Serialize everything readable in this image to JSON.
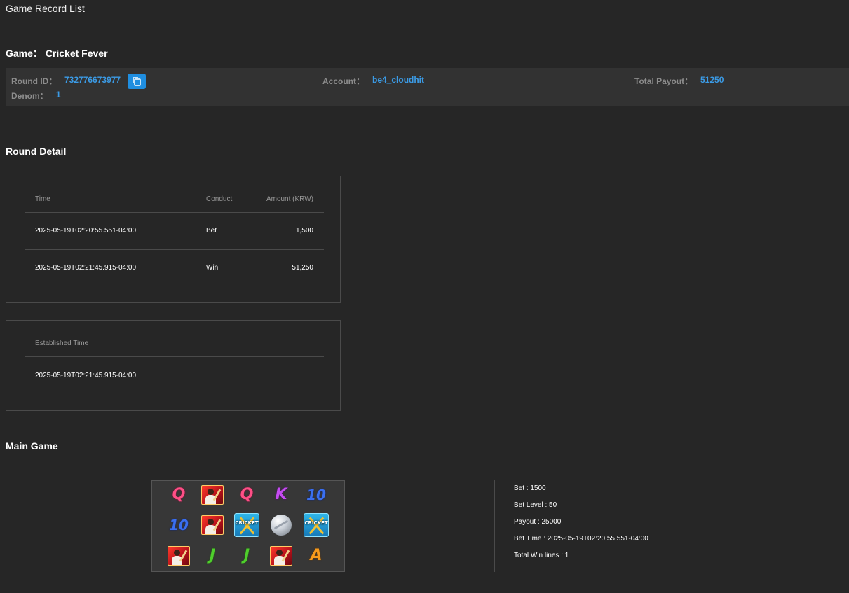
{
  "app_title": "Game Record List",
  "game": {
    "label": "Game：",
    "name": "Cricket Fever"
  },
  "round_info": {
    "round_id_label": "Round ID：",
    "round_id": "732776673977",
    "account_label": "Account：",
    "account": "be4_cloudhit",
    "total_payout_label": "Total Payout：",
    "total_payout": "51250",
    "denom_label": "Denom：",
    "denom": "1",
    "copy_icon": "copy-icon"
  },
  "round_detail": {
    "title": "Round Detail",
    "headers": {
      "time": "Time",
      "conduct": "Conduct",
      "amount": "Amount (KRW)"
    },
    "rows": [
      {
        "time": "2025-05-19T02:20:55.551-04:00",
        "conduct": "Bet",
        "amount": "1,500"
      },
      {
        "time": "2025-05-19T02:21:45.915-04:00",
        "conduct": "Win",
        "amount": "51,250"
      }
    ],
    "established": {
      "header": "Established Time",
      "value": "2025-05-19T02:21:45.915-04:00"
    }
  },
  "main_game": {
    "title": "Main Game",
    "reel_symbols": [
      [
        "Q",
        "player",
        "Q",
        "K",
        "10"
      ],
      [
        "10",
        "player",
        "cricket",
        "ball",
        "cricket"
      ],
      [
        "player",
        "J",
        "J",
        "player",
        "A"
      ]
    ],
    "cricket_logo_text": "CRICKET",
    "stats": {
      "bet": "Bet : 1500",
      "bet_level": "Bet Level : 50",
      "payout": "Payout : 25000",
      "bet_time": "Bet Time : 2025-05-19T02:20:55.551-04:00",
      "total_win_lines": "Total Win lines : 1"
    }
  }
}
